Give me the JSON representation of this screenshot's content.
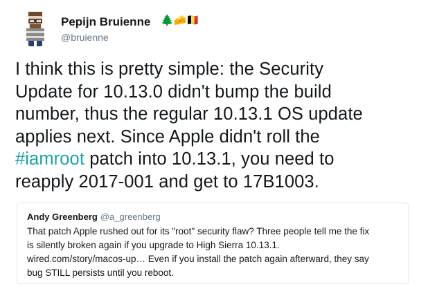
{
  "tweet": {
    "display_name": "Pepijn Bruienne",
    "name_emojis": [
      "🌲",
      "🧀",
      "🇧🇪"
    ],
    "handle": "@bruienne",
    "text_lines": [
      "I think this is pretty simple: the Security",
      "Update for 10.13.0 didn't bump the build",
      "number, thus the regular 10.13.1 OS update",
      "applies next. Since Apple didn't roll the",
      "patch into 10.13.1, you need to",
      "reapply 2017-001 and get to 17B1003."
    ],
    "hashtag": "#iamroot"
  },
  "quote": {
    "name": "Andy Greenberg",
    "handle": "@a_greenberg",
    "text_lines": [
      "That patch Apple rushed out for its \"root\" security flaw? Three people tell me the fix",
      "is silently broken again if you upgrade to High Sierra 10.13.1.",
      "wired.com/story/macos-up… Even if you install the patch again afterward, they say",
      "bug STILL persists until you reboot."
    ]
  },
  "colors": {
    "hashtag": "#1da1a8",
    "muted": "#657786",
    "border": "#e1e8ed"
  }
}
